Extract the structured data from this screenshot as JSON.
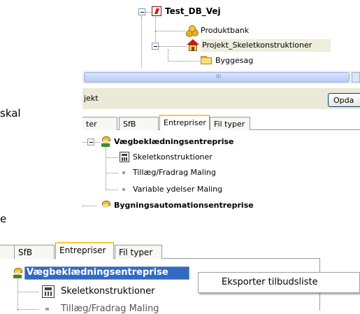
{
  "top_tree": {
    "root": "Test_DB_Vej",
    "items": [
      "Produktbank",
      "Projekt_Skeletkonstruktioner",
      "Byggesag"
    ]
  },
  "middle_panel": {
    "scrollbar_thumb": "III",
    "header_label": "jekt",
    "update_button": "Opda",
    "tabs": [
      "ter",
      "SfB",
      "Entrepriser",
      "Fil typer"
    ],
    "tree": {
      "root": "Vægbeklædningsentreprise",
      "children": [
        "Skeletkonstruktioner",
        "Tillæg/Fradrag Maling",
        "Variable ydelser Maling"
      ],
      "next": "Bygningsautomationsentreprise"
    }
  },
  "left_text": {
    "line1": "skal",
    "line2": "e"
  },
  "bottom_panel": {
    "tabs": [
      "SfB",
      "Entrepriser",
      "Fil typer"
    ],
    "tree": {
      "root": "Vægbeklædningsentreprise",
      "children": [
        "Skeletkonstruktioner",
        "Tillæg/Fradrag Maling"
      ]
    },
    "context_menu": [
      "Eksporter tilbudsliste"
    ]
  }
}
